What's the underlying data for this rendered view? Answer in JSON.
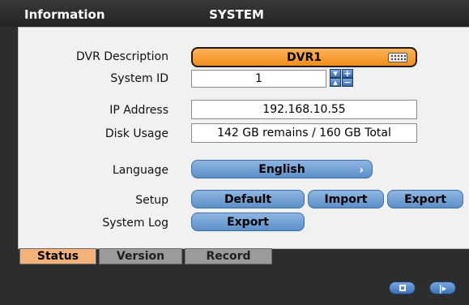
{
  "header": {
    "section": "Information",
    "title": "SYSTEM"
  },
  "fields": {
    "dvr_description": {
      "label": "DVR Description",
      "value": "DVR1",
      "icon": "keyboard-icon"
    },
    "system_id": {
      "label": "System ID",
      "value": "1"
    },
    "ip_address": {
      "label": "IP Address",
      "value": "192.168.10.55"
    },
    "disk_usage": {
      "label": "Disk Usage",
      "value": "142 GB remains / 160 GB Total"
    },
    "language": {
      "label": "Language",
      "value": "English"
    },
    "setup": {
      "label": "Setup",
      "buttons": [
        "Default",
        "Import",
        "Export"
      ]
    },
    "system_log": {
      "label": "System Log",
      "button": "Export"
    }
  },
  "tabs": [
    {
      "label": "Status",
      "active": true
    },
    {
      "label": "Version",
      "active": false
    },
    {
      "label": "Record",
      "active": false
    }
  ],
  "footer": {
    "icons": [
      "save-icon",
      "exit-icon"
    ]
  },
  "colors": {
    "accent_orange": "#f28d1c",
    "button_blue": "#5c8fc8",
    "panel": "#f1f1f1",
    "background": "#2d2d2d"
  }
}
